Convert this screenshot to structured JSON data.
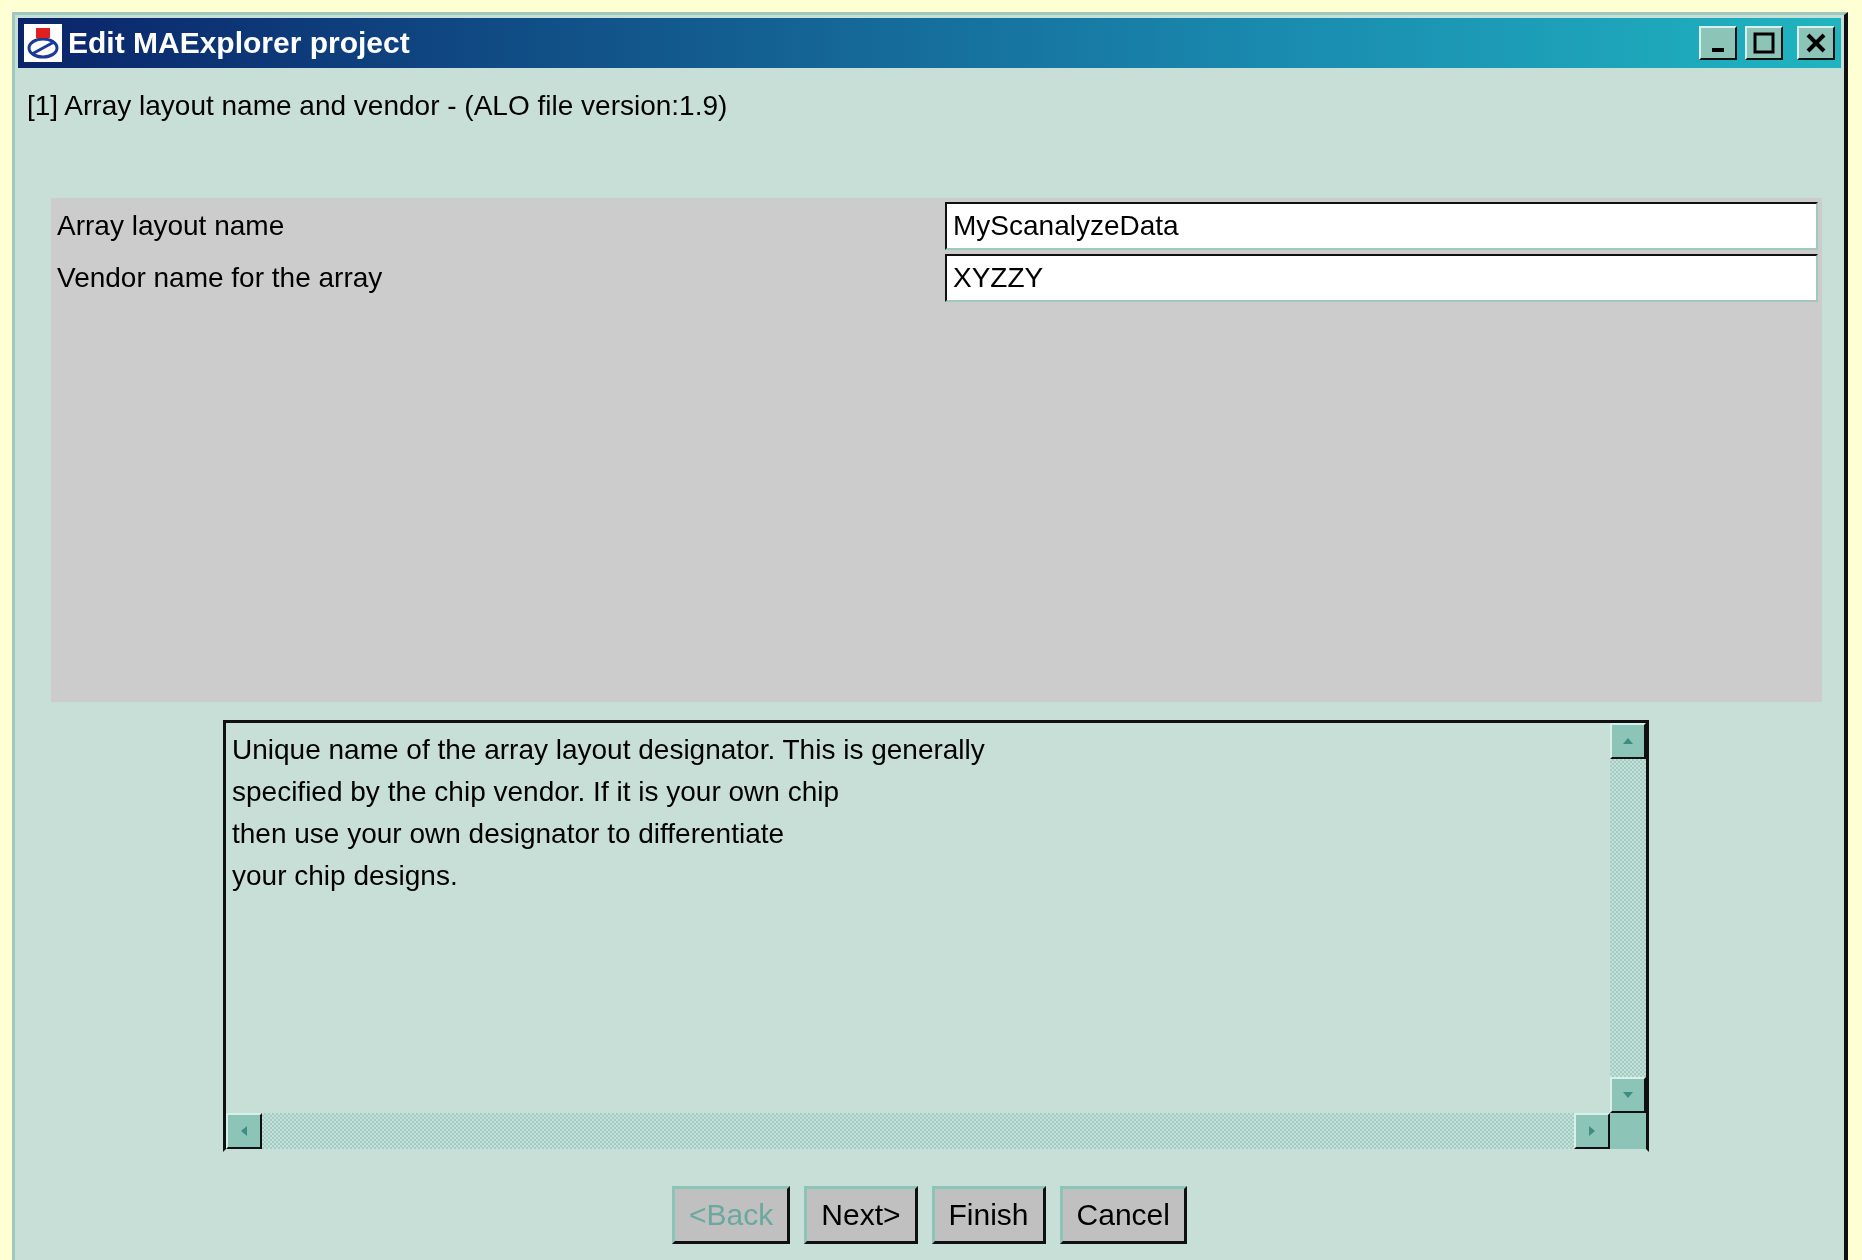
{
  "window": {
    "title": "Edit MAExplorer project"
  },
  "step_heading": "[1] Array layout name and vendor - (ALO file version:1.9)",
  "fields": [
    {
      "label": "Array layout name",
      "value": "MyScanalyzeData"
    },
    {
      "label": "Vendor name for the array",
      "value": "XYZZY"
    }
  ],
  "description": {
    "lines": [
      "Unique name of the array layout designator. This is generally",
      "specified by the chip vendor. If it is your own chip",
      "then use your own designator to differentiate",
      "your chip designs."
    ]
  },
  "buttons": [
    {
      "label": "<Back",
      "disabled": true
    },
    {
      "label": "Next>",
      "disabled": false
    },
    {
      "label": "Finish",
      "disabled": false
    },
    {
      "label": "Cancel",
      "disabled": false
    }
  ]
}
